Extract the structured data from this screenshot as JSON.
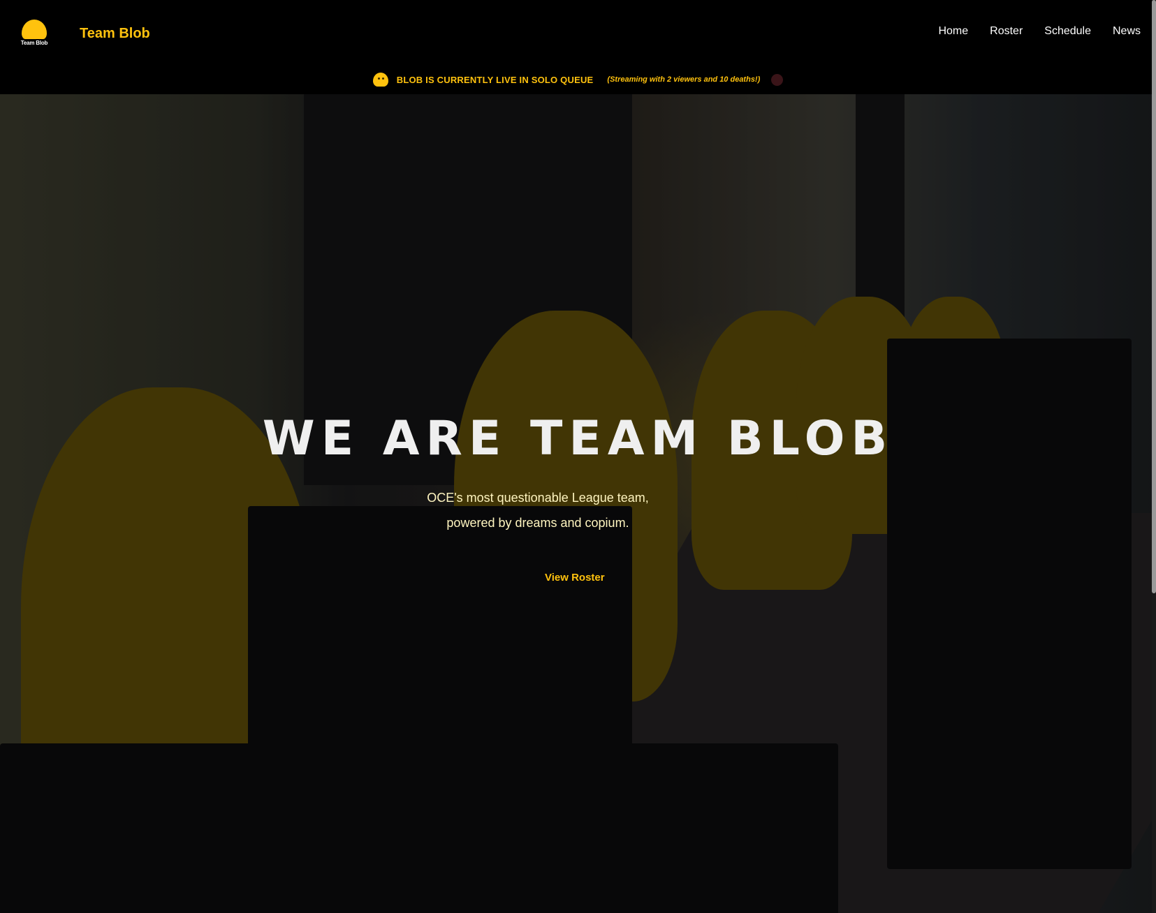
{
  "header": {
    "logo_text": "Team Blob",
    "brand_name": "Team Blob",
    "nav": [
      {
        "label": "Home"
      },
      {
        "label": "Roster"
      },
      {
        "label": "Schedule"
      },
      {
        "label": "News"
      }
    ],
    "brand_color": "#ffc20e"
  },
  "ticker": {
    "live_text": "BLOB IS CURRENTLY LIVE IN SOLO QUEUE",
    "live_sub": "(Streaming with 2 viewers and 10 deaths!)"
  },
  "hero": {
    "title": "WE ARE TEAM BLOB",
    "subtitle_line1": "OCE's most questionable League team,",
    "subtitle_line2": "powered by dreams and copium.",
    "cta_label": "View Roster"
  }
}
